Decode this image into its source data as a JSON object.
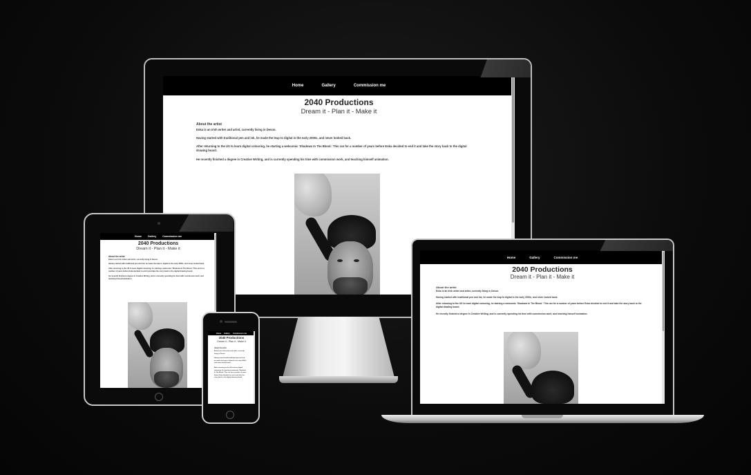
{
  "site": {
    "nav": [
      "Home",
      "Gallery",
      "Commission me"
    ],
    "title": "2040 Productions",
    "tagline": "Dream it - Plan it - Make it",
    "about_heading": "About the artist",
    "paragraphs": [
      "Enka is an Irish writer and artist, currently living in Devon.",
      "Having started with traditional pen and ink, he made the leap to digital in the early 2000s, and never looked back.",
      "After returning to the US to learn digital colouring, he starting a webcomic 'Shadows In The Blood.' This ran for a number of years before Enka decided to end it and take the story back to the digital drawing board.",
      "He recently finished a degree in Creative Writing, and is currently spending his time with commission work, and teaching himself animation."
    ],
    "photo_icon": "portrait-photo-with-marker"
  },
  "colors": {
    "nav_bg": "#000000",
    "page_bg": "#ffffff",
    "background": "#0b0b0b"
  }
}
